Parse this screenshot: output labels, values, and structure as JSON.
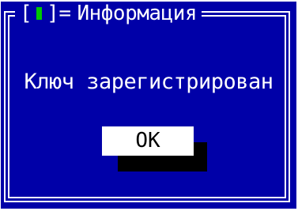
{
  "dialog": {
    "close_open": "[",
    "close_close": "]",
    "title_eq": "=",
    "title": "Информация",
    "message": "Ключ зарегистрирован",
    "ok_label": "OK"
  },
  "colors": {
    "background": "#0000a8",
    "frame": "#ffffff",
    "close_glyph": "#00c800",
    "button_bg": "#ffffff",
    "button_text": "#000000",
    "shadow": "#000000"
  },
  "icons": {
    "close": "close-icon"
  }
}
